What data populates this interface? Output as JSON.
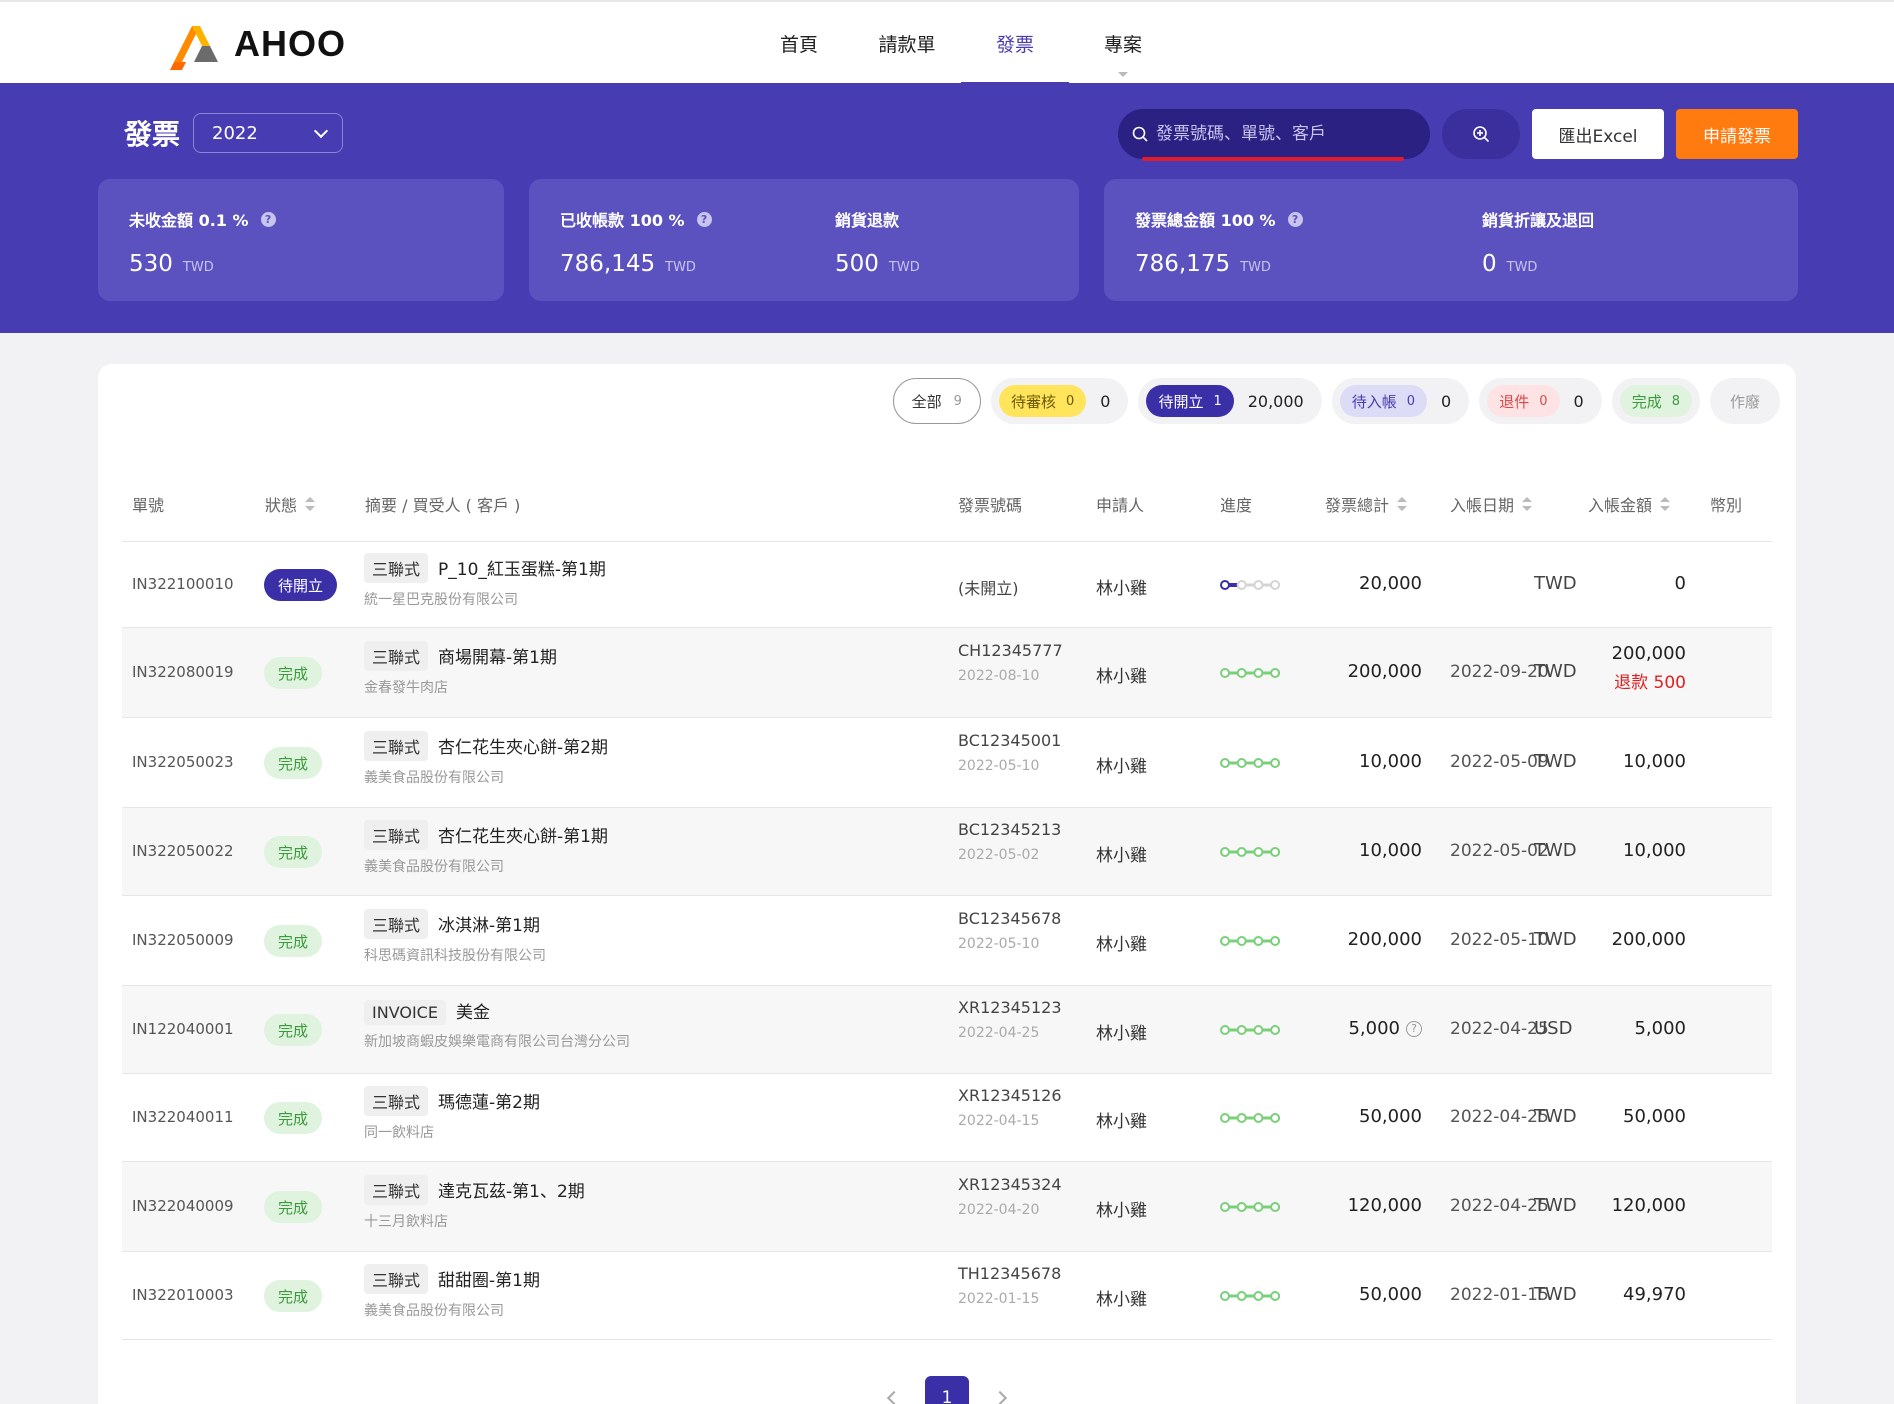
{
  "brand": {
    "name": "AHOO"
  },
  "nav": [
    {
      "label": "首頁",
      "active": false
    },
    {
      "label": "請款單",
      "active": false
    },
    {
      "label": "發票",
      "active": true
    },
    {
      "label": "專案",
      "active": false
    }
  ],
  "header": {
    "title": "發票",
    "year": "2022",
    "search_placeholder": "發票號碼、單號、客戶",
    "export_label": "匯出Excel",
    "apply_label": "申請發票"
  },
  "stats": {
    "unreceived": {
      "label": "未收金額 0.1 %",
      "value": "530",
      "unit": "TWD"
    },
    "received": {
      "label": "已收帳款 100 %",
      "value": "786,145",
      "unit": "TWD"
    },
    "returns": {
      "label": "銷貨退款",
      "value": "500",
      "unit": "TWD"
    },
    "total": {
      "label": "發票總金額 100 %",
      "value": "786,175",
      "unit": "TWD"
    },
    "discount": {
      "label": "銷貨折讓及退回",
      "value": "0",
      "unit": "TWD"
    }
  },
  "filters": {
    "all": {
      "label": "全部",
      "count": "9"
    },
    "review": {
      "label": "待審核",
      "count": "0",
      "amount": "0"
    },
    "pending": {
      "label": "待開立",
      "count": "1",
      "amount": "20,000"
    },
    "posting": {
      "label": "待入帳",
      "count": "0",
      "amount": "0"
    },
    "returned": {
      "label": "退件",
      "count": "0",
      "amount": "0"
    },
    "done": {
      "label": "完成",
      "count": "8"
    },
    "void": {
      "label": "作廢"
    }
  },
  "columns": {
    "no": "單號",
    "status": "狀態",
    "summary": "摘要 / 買受人 ( 客戶 )",
    "invoice": "發票號碼",
    "user": "申請人",
    "progress": "進度",
    "total": "發票總計",
    "post_date": "入帳日期",
    "post_amount": "入帳金額",
    "currency": "幣別"
  },
  "rows": [
    {
      "no": "IN322100010",
      "status": "待開立",
      "type": "三聯式",
      "title": "P_10_紅玉蛋糕-第1期",
      "customer": "統一星巴克股份有限公司",
      "invoice": "(未開立)",
      "inv_date": "",
      "user": "林小雞",
      "progress": 0.25,
      "total": "20,000",
      "post_date": "",
      "amount": "0",
      "refund": "",
      "currency": "TWD"
    },
    {
      "no": "IN322080019",
      "status": "完成",
      "type": "三聯式",
      "title": "商場開幕-第1期",
      "customer": "金春發牛肉店",
      "invoice": "CH12345777",
      "inv_date": "2022-08-10",
      "user": "林小雞",
      "progress": 1,
      "total": "200,000",
      "post_date": "2022-09-20",
      "amount": "200,000",
      "refund": "退款 500",
      "currency": "TWD"
    },
    {
      "no": "IN322050023",
      "status": "完成",
      "type": "三聯式",
      "title": "杏仁花生夾心餅-第2期",
      "customer": "義美食品股份有限公司",
      "invoice": "BC12345001",
      "inv_date": "2022-05-10",
      "user": "林小雞",
      "progress": 1,
      "total": "10,000",
      "post_date": "2022-05-09",
      "amount": "10,000",
      "refund": "",
      "currency": "TWD"
    },
    {
      "no": "IN322050022",
      "status": "完成",
      "type": "三聯式",
      "title": "杏仁花生夾心餅-第1期",
      "customer": "義美食品股份有限公司",
      "invoice": "BC12345213",
      "inv_date": "2022-05-02",
      "user": "林小雞",
      "progress": 1,
      "total": "10,000",
      "post_date": "2022-05-02",
      "amount": "10,000",
      "refund": "",
      "currency": "TWD"
    },
    {
      "no": "IN322050009",
      "status": "完成",
      "type": "三聯式",
      "title": "冰淇淋-第1期",
      "customer": "科思碼資訊科技股份有限公司",
      "invoice": "BC12345678",
      "inv_date": "2022-05-10",
      "user": "林小雞",
      "progress": 1,
      "total": "200,000",
      "post_date": "2022-05-10",
      "amount": "200,000",
      "refund": "",
      "currency": "TWD"
    },
    {
      "no": "IN122040001",
      "status": "完成",
      "type": "INVOICE",
      "title": "美金",
      "customer": "新加坡商蝦皮娛樂電商有限公司台灣分公司",
      "invoice": "XR12345123",
      "inv_date": "2022-04-25",
      "user": "林小雞",
      "progress": 1,
      "total": "5,000",
      "total_help": "?",
      "post_date": "2022-04-25",
      "amount": "5,000",
      "refund": "",
      "currency": "USD"
    },
    {
      "no": "IN322040011",
      "status": "完成",
      "type": "三聯式",
      "title": "瑪德蓮-第2期",
      "customer": "同一飲料店",
      "invoice": "XR12345126",
      "inv_date": "2022-04-15",
      "user": "林小雞",
      "progress": 1,
      "total": "50,000",
      "post_date": "2022-04-25",
      "amount": "50,000",
      "refund": "",
      "currency": "TWD"
    },
    {
      "no": "IN322040009",
      "status": "完成",
      "type": "三聯式",
      "title": "達克瓦茲-第1、2期",
      "customer": "十三月飲料店",
      "invoice": "XR12345324",
      "inv_date": "2022-04-20",
      "user": "林小雞",
      "progress": 1,
      "total": "120,000",
      "post_date": "2022-04-25",
      "amount": "120,000",
      "refund": "",
      "currency": "TWD"
    },
    {
      "no": "IN322010003",
      "status": "完成",
      "type": "三聯式",
      "title": "甜甜圈-第1期",
      "customer": "義美食品股份有限公司",
      "invoice": "TH12345678",
      "inv_date": "2022-01-15",
      "user": "林小雞",
      "progress": 1,
      "total": "50,000",
      "post_date": "2022-01-15",
      "amount": "49,970",
      "refund": "",
      "currency": "TWD"
    }
  ],
  "pagination": {
    "current": "1"
  },
  "colors": {
    "primary": "#473cb2",
    "accent": "#ff7a0f",
    "success": "#3b9a3b",
    "danger": "#e02020"
  }
}
